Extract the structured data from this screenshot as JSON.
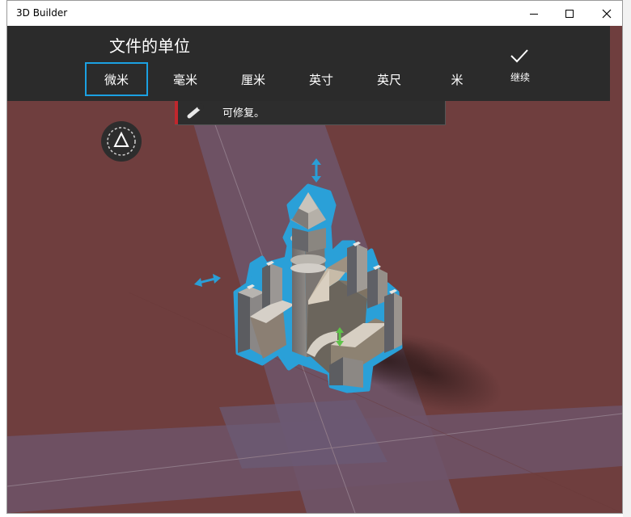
{
  "window": {
    "title": "3D Builder"
  },
  "units_panel": {
    "title": "文件的单位",
    "units": [
      {
        "label": "微米",
        "selected": true
      },
      {
        "label": "毫米",
        "selected": false
      },
      {
        "label": "厘米",
        "selected": false
      },
      {
        "label": "英寸",
        "selected": false
      },
      {
        "label": "英尺",
        "selected": false
      },
      {
        "label": "米",
        "selected": false
      }
    ],
    "continue_label": "继续"
  },
  "notice": {
    "text": "可修复。"
  },
  "colors": {
    "accent": "#1ba1e2",
    "floor": "#6f3e3e",
    "panel": "#2b2b2b",
    "selection_outline": "#2aa0d8",
    "warning_accent": "#c1272d"
  },
  "icons": [
    "minimize-icon",
    "maximize-icon",
    "close-icon",
    "checkmark-icon",
    "wrench-icon",
    "object-tool-icon",
    "move-arrow-icon",
    "vertical-arrow-icon",
    "lift-arrow-icon"
  ]
}
